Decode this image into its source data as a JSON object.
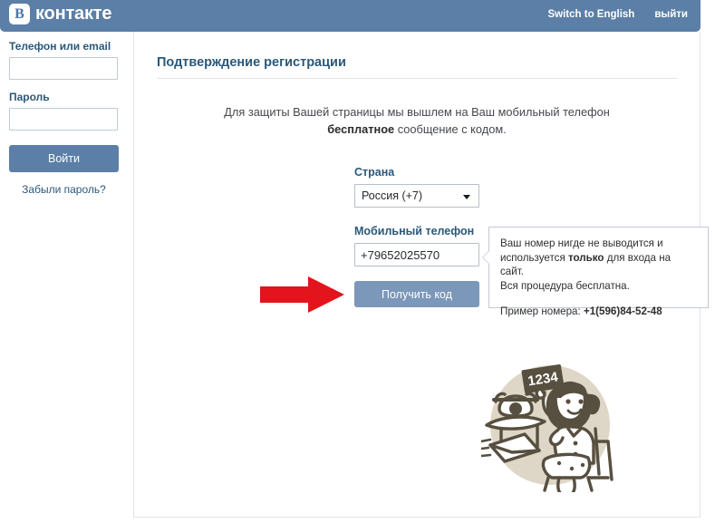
{
  "header": {
    "logo_mark": "В",
    "logo_text": "контакте",
    "links": [
      {
        "label": "Switch to English",
        "name": "switch-to-english-link"
      },
      {
        "label": "выйти",
        "name": "logout-link"
      }
    ]
  },
  "sidebar": {
    "login_label": "Телефон или email",
    "login_value": "",
    "login_placeholder": "",
    "password_label": "Пароль",
    "password_value": "",
    "password_placeholder": "",
    "login_button": "Войти",
    "forgot_link": "Забыли пароль?"
  },
  "main": {
    "title": "Подтверждение регистрации",
    "intro_line1": "Для защиты Вашей страницы мы вышлем на Ваш мобильный телефон",
    "intro_bold": "бесплатное",
    "intro_line2_tail": " сообщение с кодом.",
    "country_label": "Страна",
    "country_value": "Россия (+7)",
    "phone_label": "Мобильный телефон",
    "phone_value": "+79652025570",
    "phone_placeholder": "",
    "submit_button": "Получить код"
  },
  "tooltip": {
    "line1": "Ваш номер нигде не выводится и",
    "line2_pre": "используется ",
    "line2_bold": "только",
    "line2_post": " для входа на сайт.",
    "line3": "Вся процедура бесплатна.",
    "example_label": "Пример номера: ",
    "example_value": "+1(596)84-52-48"
  },
  "illustration": {
    "card_number": "1234",
    "alt": "woman-holding-code-card-with-telephone-and-letter"
  },
  "colors": {
    "header_blue": "#5b7fa6",
    "link_blue": "#2b587a",
    "button_blue": "#5b7fa6",
    "submit_blue": "#7b97b9",
    "arrow_red": "#e3141c",
    "illustration_ink": "#574f3f",
    "illustration_disc": "#ded7c7"
  }
}
